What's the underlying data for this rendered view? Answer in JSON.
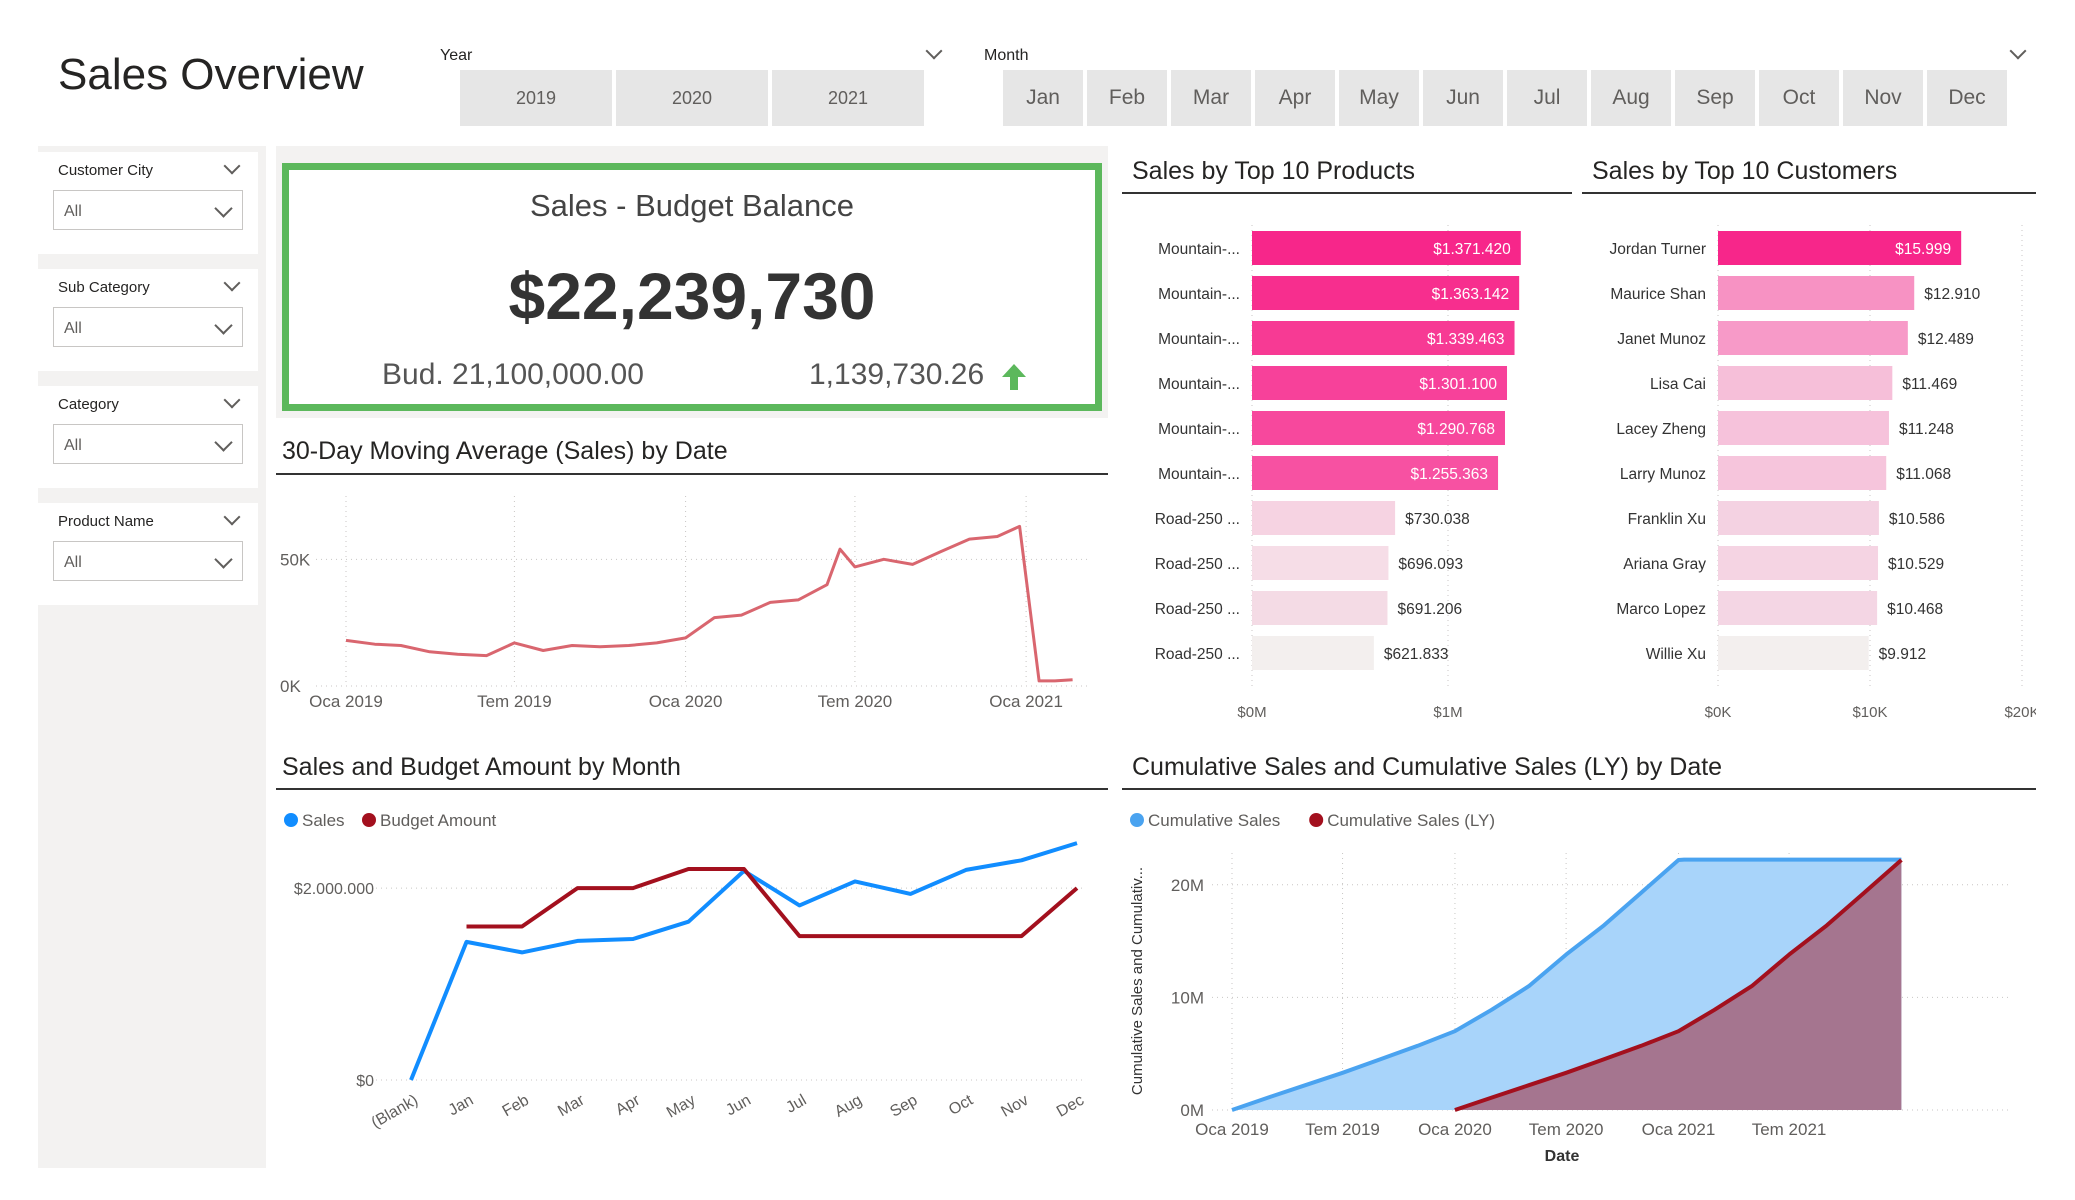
{
  "header": {
    "title": "Sales Overview",
    "year_slicer": {
      "label": "Year",
      "options": [
        "2019",
        "2020",
        "2021"
      ]
    },
    "month_slicer": {
      "label": "Month",
      "options": [
        "Jan",
        "Feb",
        "Mar",
        "Apr",
        "May",
        "Jun",
        "Jul",
        "Aug",
        "Sep",
        "Oct",
        "Nov",
        "Dec"
      ]
    }
  },
  "filters": [
    {
      "label": "Customer City",
      "value": "All"
    },
    {
      "label": "Sub Category",
      "value": "All"
    },
    {
      "label": "Category",
      "value": "All"
    },
    {
      "label": "Product Name",
      "value": "All"
    }
  ],
  "kpi": {
    "title": "Sales - Budget Balance",
    "value": "$22,239,730",
    "budget_text": "Bud. 21,100,000.00",
    "diff_text": "1,139,730.26",
    "status_color": "#5cb85c",
    "trend_icon": "arrow-up-icon"
  },
  "chart_data": [
    {
      "type": "line",
      "title": "30-Day Moving Average (Sales) by Date",
      "xlabel": "",
      "ylabel": "",
      "x_ticks": [
        "Oca 2019",
        "Tem 2019",
        "Oca 2020",
        "Tem 2020",
        "Oca 2021"
      ],
      "y_ticks": [
        "0K",
        "50K"
      ],
      "ylim": [
        0,
        75000
      ],
      "grid": true,
      "color": "#d9666f",
      "x": [
        "2019-01-01",
        "2019-02-01",
        "2019-03-01",
        "2019-04-01",
        "2019-05-01",
        "2019-06-01",
        "2019-07-01",
        "2019-08-01",
        "2019-09-01",
        "2019-10-01",
        "2019-11-01",
        "2019-12-01",
        "2020-01-01",
        "2020-02-01",
        "2020-03-01",
        "2020-04-01",
        "2020-05-01",
        "2020-06-01",
        "2020-06-15",
        "2020-07-01",
        "2020-08-01",
        "2020-09-01",
        "2020-10-01",
        "2020-11-01",
        "2020-12-01",
        "2020-12-25",
        "2021-01-15",
        "2021-02-01",
        "2021-02-20"
      ],
      "values": [
        18000,
        16500,
        16000,
        13500,
        12500,
        12000,
        17000,
        14000,
        16000,
        15500,
        16000,
        17000,
        19000,
        27000,
        28000,
        33000,
        34000,
        40000,
        54000,
        47000,
        50000,
        48000,
        53000,
        58000,
        59000,
        63000,
        2000,
        2000,
        2500
      ]
    },
    {
      "type": "bar",
      "title": "Sales by Top 10 Products",
      "xlabel": "",
      "ylabel": "",
      "categories": [
        "Mountain-...",
        "Mountain-...",
        "Mountain-...",
        "Mountain-...",
        "Mountain-...",
        "Mountain-...",
        "Road-250 ...",
        "Road-250 ...",
        "Road-250 ...",
        "Road-250 ..."
      ],
      "values": [
        1371420,
        1363142,
        1339463,
        1301100,
        1290768,
        1255363,
        730038,
        696093,
        691206,
        621833
      ],
      "labels": [
        "$1.371.420",
        "$1.363.142",
        "$1.339.463",
        "$1.301.100",
        "$1.290.768",
        "$1.255.363",
        "$730.038",
        "$696.093",
        "$691.206",
        "$621.833"
      ],
      "colors": [
        "#f7268a",
        "#f72e8e",
        "#f73a94",
        "#f7419a",
        "#f7489d",
        "#f751a2",
        "#f6d3e2",
        "#f6dde7",
        "#f4dbe5",
        "#f3efee"
      ],
      "x_ticks": [
        "$0M",
        "$1M"
      ],
      "xlim": [
        0,
        1500000
      ],
      "grid": true
    },
    {
      "type": "bar",
      "title": "Sales by Top 10 Customers",
      "xlabel": "",
      "ylabel": "",
      "categories": [
        "Jordan Turner",
        "Maurice Shan",
        "Janet Munoz",
        "Lisa Cai",
        "Lacey Zheng",
        "Larry Munoz",
        "Franklin Xu",
        "Ariana Gray",
        "Marco Lopez",
        "Willie Xu"
      ],
      "values": [
        15999,
        12910,
        12489,
        11469,
        11248,
        11068,
        10586,
        10529,
        10468,
        9912
      ],
      "labels": [
        "$15.999",
        "$12.910",
        "$12.489",
        "$11.469",
        "$11.248",
        "$11.068",
        "$10.586",
        "$10.529",
        "$10.468",
        "$9.912"
      ],
      "colors": [
        "#f7268a",
        "#f792c3",
        "#f79ac8",
        "#f6bfd9",
        "#f6c2db",
        "#f6c5dc",
        "#f4d2e2",
        "#f5d4e3",
        "#f4d6e4",
        "#f3efee"
      ],
      "x_ticks": [
        "$0K",
        "$10K",
        "$20K"
      ],
      "xlim": [
        0,
        20000
      ],
      "grid": true
    },
    {
      "type": "line",
      "title": "Sales and Budget Amount by Month",
      "xlabel": "",
      "ylabel": "",
      "categories": [
        "(Blank)",
        "Jan",
        "Feb",
        "Mar",
        "Apr",
        "May",
        "Jun",
        "Jul",
        "Aug",
        "Sep",
        "Oct",
        "Nov",
        "Dec"
      ],
      "y_ticks": [
        "$0",
        "$2.000.000"
      ],
      "ylim": [
        0,
        2700000
      ],
      "grid": true,
      "legend": "top-left",
      "series": [
        {
          "name": "Sales",
          "color": "#118dff",
          "values": [
            0,
            1440000,
            1330000,
            1450000,
            1470000,
            1650000,
            2180000,
            1820000,
            2070000,
            1940000,
            2190000,
            2290000,
            2470000
          ]
        },
        {
          "name": "Budget Amount",
          "color": "#a3101e",
          "values": [
            null,
            1600000,
            1600000,
            2000000,
            2000000,
            2200000,
            2200000,
            1500000,
            1500000,
            1500000,
            1500000,
            1500000,
            2000000
          ]
        }
      ]
    },
    {
      "type": "area",
      "title": "Cumulative Sales and Cumulative Sales (LY) by Date",
      "xlabel": "Date",
      "ylabel": "Cumulative Sales and Cumulativ...",
      "x_ticks": [
        "Oca 2019",
        "Tem 2019",
        "Oca 2020",
        "Tem 2020",
        "Oca 2021",
        "Tem 2021"
      ],
      "y_ticks": [
        "0M",
        "10M",
        "20M"
      ],
      "ylim": [
        0,
        23000000
      ],
      "grid": true,
      "legend": "top-left",
      "series": [
        {
          "name": "Cumulative Sales",
          "color": "#4aa3f0",
          "fill": "#a8d4fa",
          "x": [
            "2019-01-01",
            "2019-03-01",
            "2019-05-01",
            "2019-07-01",
            "2019-09-01",
            "2019-11-01",
            "2020-01-01",
            "2020-03-01",
            "2020-05-01",
            "2020-07-01",
            "2020-09-01",
            "2020-11-01",
            "2021-01-01",
            "2021-01-10",
            "2021-03-01",
            "2021-05-01",
            "2021-07-01",
            "2021-09-01",
            "2021-11-01",
            "2022-01-01"
          ],
          "values": [
            0,
            1100000,
            2200000,
            3300000,
            4500000,
            5700000,
            7000000,
            8900000,
            11000000,
            13800000,
            16400000,
            19300000,
            22200000,
            22239730,
            22239730,
            22239730,
            22239730,
            22239730,
            22239730,
            22239730
          ]
        },
        {
          "name": "Cumulative Sales (LY)",
          "color": "#a3101e",
          "fill": "#a5758f",
          "x": [
            "2020-01-01",
            "2020-03-01",
            "2020-05-01",
            "2020-07-01",
            "2020-09-01",
            "2020-11-01",
            "2021-01-01",
            "2021-03-01",
            "2021-05-01",
            "2021-07-01",
            "2021-09-01",
            "2021-11-01",
            "2022-01-01"
          ],
          "values": [
            0,
            1100000,
            2200000,
            3300000,
            4500000,
            5700000,
            7000000,
            8900000,
            11000000,
            13800000,
            16400000,
            19300000,
            22200000
          ]
        }
      ]
    }
  ]
}
